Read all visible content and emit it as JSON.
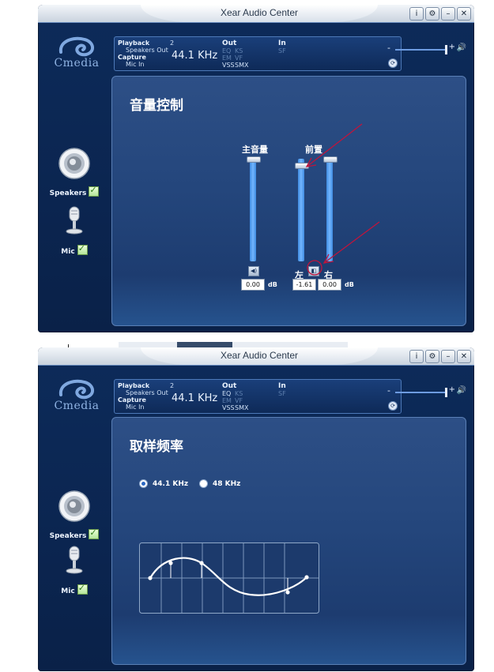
{
  "window_title": "Xear Audio Center",
  "window_buttons": [
    "i",
    "⚙",
    "–",
    "✕"
  ],
  "logo_text": "Cmedia",
  "info": {
    "playback_label": "Playback",
    "playback_device": "Speakers Out",
    "capture_label": "Capture",
    "capture_device": "Mic In",
    "channels": "2",
    "sample_rate": "44.1 KHz",
    "out_label": "Out",
    "out_eq": "EQ",
    "out_ks": "KS",
    "out_em": "EM",
    "out_vf": "VF",
    "out_vss": "VSS",
    "out_smx": "SMX",
    "in_label": "In",
    "in_sf": "SF"
  },
  "master_volume": {
    "minus": "-",
    "plus": "+",
    "level": 0.82
  },
  "sidebar": {
    "speakers_label": "Speakers",
    "mic_label": "Mic"
  },
  "volume_panel": {
    "title": "音量控制",
    "main_label": "主音量",
    "front_label": "前置",
    "left_label": "左",
    "right_label": "右",
    "main_value": "0.00",
    "left_value": "-1.61",
    "right_value": "0.00",
    "db_unit": "dB",
    "main_level": 1.0,
    "left_level": 0.94,
    "right_level": 1.0
  },
  "rate_panel": {
    "title": "取样频率",
    "option_44": "44.1 KHz",
    "option_48": "48 KHz",
    "selected": "44.1 KHz"
  },
  "colors": {
    "window_bg": "#0d2b5a",
    "panel_bg": "#24467c",
    "slider": "#4c9bf0",
    "annotation": "#c0143c",
    "checkbox": "#2f7a18"
  }
}
